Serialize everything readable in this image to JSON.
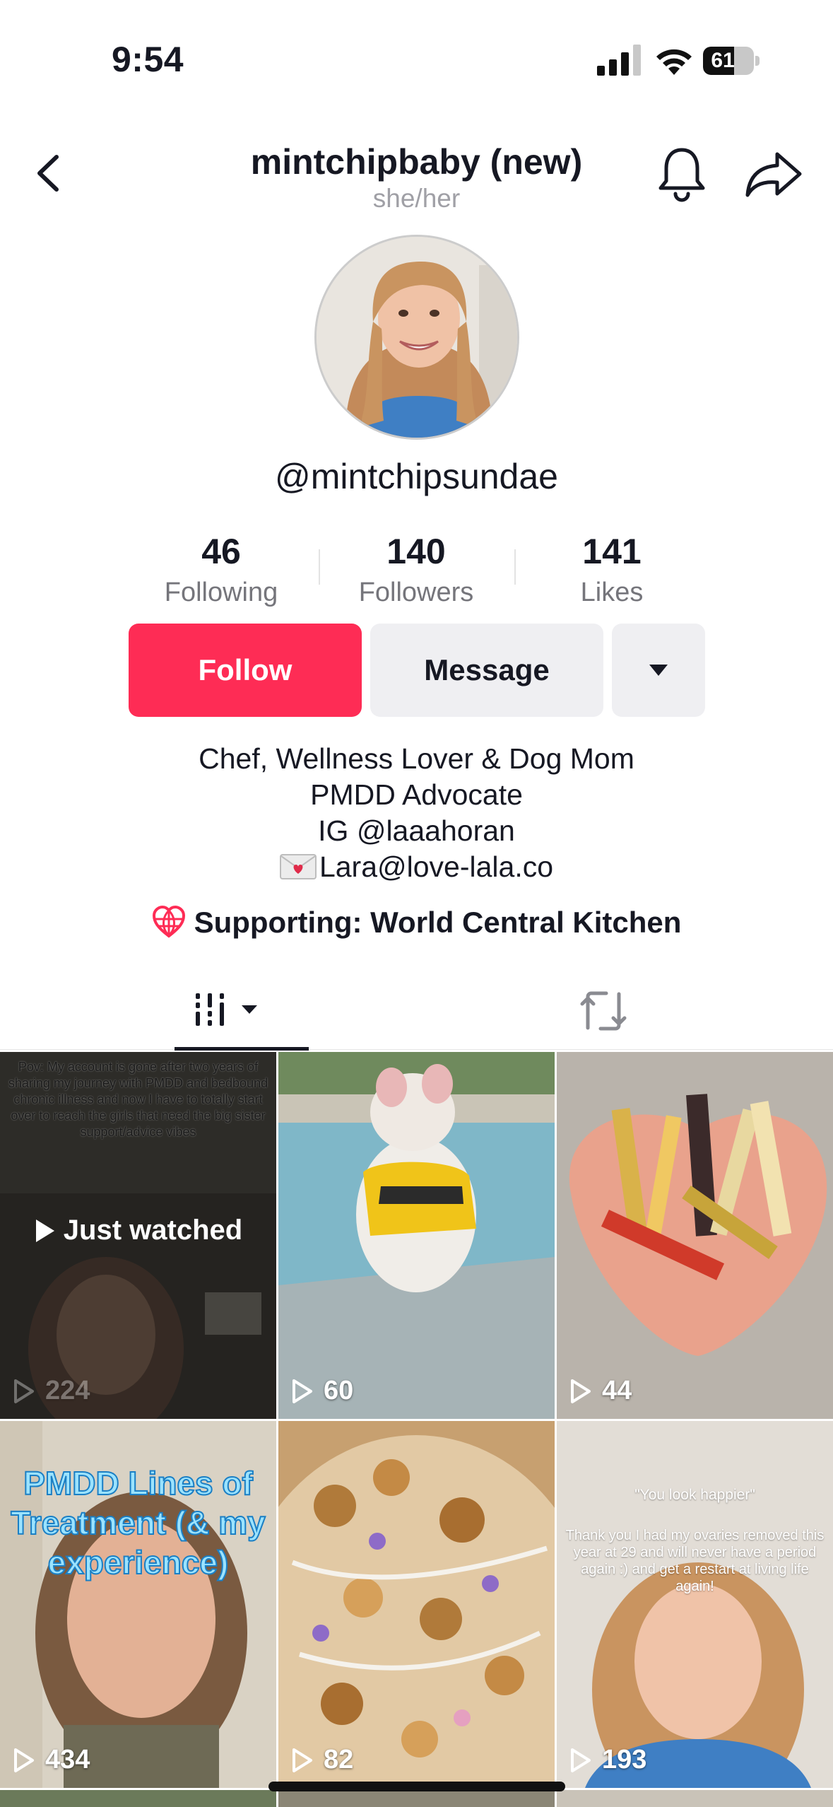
{
  "status_bar": {
    "time": "9:54",
    "battery_level": "61",
    "icons": [
      "signal-icon",
      "wifi-icon",
      "battery-icon"
    ]
  },
  "header": {
    "title": "mintchipbaby (new)",
    "pronouns": "she/her",
    "icons": [
      "back-chevron-icon",
      "bell-icon",
      "share-arrow-icon"
    ]
  },
  "profile": {
    "username": "@mintchipsundae",
    "stats": [
      {
        "value": "46",
        "label": "Following"
      },
      {
        "value": "140",
        "label": "Followers"
      },
      {
        "value": "141",
        "label": "Likes"
      }
    ],
    "buttons": {
      "follow": "Follow",
      "message": "Message",
      "more_icon": "caret-down-icon"
    },
    "bio_lines": [
      "Chef, Wellness Lover & Dog Mom",
      "PMDD Advocate",
      "IG @laaahoran",
      "Lara@love-lala.co"
    ],
    "supporting": "Supporting: World Central Kitchen"
  },
  "tabs": {
    "videos_icon": "video-grid-icon",
    "repost_icon": "repost-icon"
  },
  "videos": [
    {
      "views": "224",
      "badge": "Just watched",
      "caption": "Pov: My account is gone after two years of sharing my journey with PMDD and bedbound chronic illness and now I have to totally start over to reach the girls that need the big sister support/advice vibes"
    },
    {
      "views": "60"
    },
    {
      "views": "44"
    },
    {
      "views": "434",
      "caption": "PMDD Lines of Treatment (& my experience)"
    },
    {
      "views": "82"
    },
    {
      "views": "193",
      "caption_title": "\"You look happier\"",
      "caption": "Thank you I had my ovaries removed this year at 29 and will never have a period again :) and get a restart at living life again!"
    }
  ],
  "colors": {
    "follow": "#fe2c55",
    "secondary_button": "#efeff2",
    "muted_text": "#75757b"
  }
}
